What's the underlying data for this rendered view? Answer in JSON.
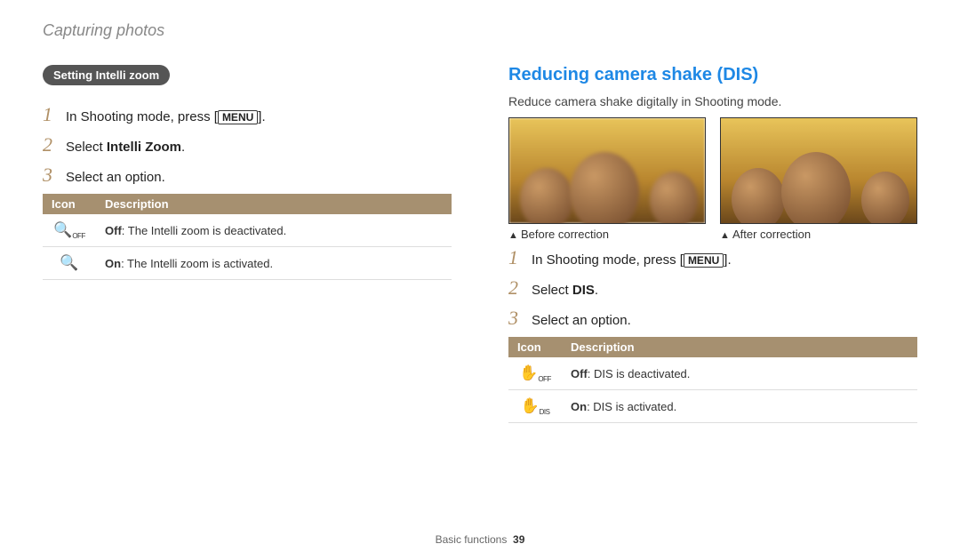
{
  "header": {
    "title": "Capturing photos"
  },
  "left": {
    "pill": "Setting Intelli zoom",
    "steps": [
      {
        "pre": "In Shooting mode, press [",
        "btn": "MENU",
        "post": "]."
      },
      {
        "pre": "Select ",
        "bold": "Intelli Zoom",
        "post": "."
      },
      {
        "pre": "Select an option."
      }
    ],
    "table": {
      "h1": "Icon",
      "h2": "Description",
      "rows": [
        {
          "icon": "🔍",
          "sub": "OFF",
          "b": "Off",
          "rest": ": The Intelli zoom is deactivated."
        },
        {
          "icon": "🔍",
          "sub": "",
          "b": "On",
          "rest": ": The Intelli zoom is activated."
        }
      ]
    }
  },
  "right": {
    "title": "Reducing camera shake (DIS)",
    "intro": "Reduce camera shake digitally in Shooting mode.",
    "captions": {
      "before": "Before correction",
      "after": "After correction"
    },
    "steps": [
      {
        "pre": "In Shooting mode, press [",
        "btn": "MENU",
        "post": "]."
      },
      {
        "pre": "Select ",
        "bold": "DIS",
        "post": "."
      },
      {
        "pre": "Select an option."
      }
    ],
    "table": {
      "h1": "Icon",
      "h2": "Description",
      "rows": [
        {
          "icon": "✋",
          "sub": "OFF",
          "b": "Off",
          "rest": ": DIS is deactivated."
        },
        {
          "icon": "✋",
          "sub": "DIS",
          "b": "On",
          "rest": ": DIS is activated."
        }
      ]
    }
  },
  "footer": {
    "section": "Basic functions",
    "page": "39"
  }
}
